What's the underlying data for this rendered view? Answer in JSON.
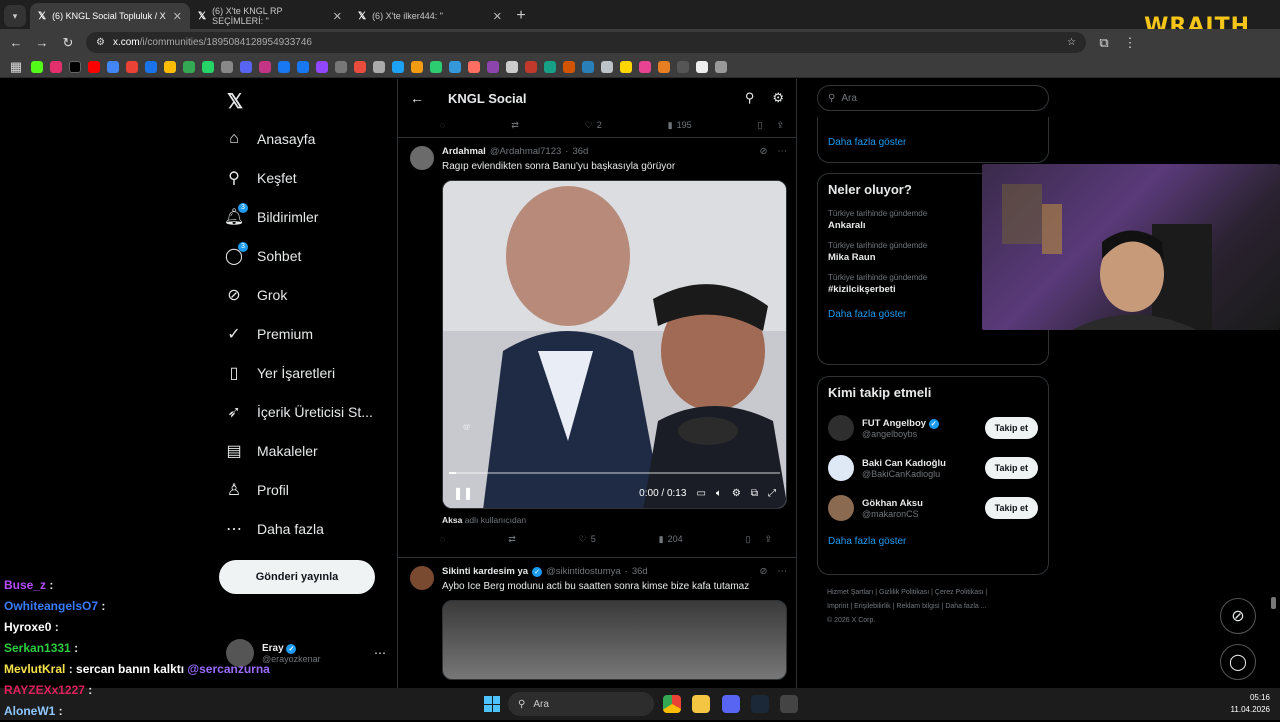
{
  "browser": {
    "tabs": [
      {
        "label": "(6) KNGL Social Topluluk / X",
        "active": true
      },
      {
        "label": "(6) X'te KNGL RP SEÇİMLERİ: \"",
        "active": false
      },
      {
        "label": "(6) X'te ilker444: \"",
        "active": false
      }
    ],
    "url_host": "x.com",
    "url_path": "/i/communities/1895084128954933746",
    "overlay_brand": "WRAITH"
  },
  "sidebar": {
    "items": [
      {
        "label": "Anasayfa",
        "icon": "home-icon"
      },
      {
        "label": "Keşfet",
        "icon": "search-icon"
      },
      {
        "label": "Bildirimler",
        "icon": "bell-icon",
        "badge": "3"
      },
      {
        "label": "Sohbet",
        "icon": "chat-icon",
        "badge": "3"
      },
      {
        "label": "Grok",
        "icon": "grok-icon"
      },
      {
        "label": "Premium",
        "icon": "verified-icon"
      },
      {
        "label": "Yer İşaretleri",
        "icon": "bookmark-icon"
      },
      {
        "label": "İçerik Üreticisi St...",
        "icon": "rocket-icon"
      },
      {
        "label": "Makaleler",
        "icon": "article-icon"
      },
      {
        "label": "Profil",
        "icon": "person-icon"
      },
      {
        "label": "Daha fazla",
        "icon": "more-icon"
      }
    ],
    "post_button": "Gönderi yayınla",
    "account": {
      "name": "Eray",
      "handle": "@erayozkenar"
    }
  },
  "main": {
    "title": "KNGL Social",
    "prev_post_stats": {
      "replies": "",
      "reposts": "",
      "likes": "2",
      "views": "195"
    },
    "posts": [
      {
        "name": "Ardahmal",
        "handle": "@Ardahmal7123",
        "age": "36d",
        "text": "Ragıp evlendikten sonra Banu'yu başkasıyla görüyor",
        "video_time": "0:00 / 0:13",
        "video_progress": 0.02,
        "credit_strong": "Aksa",
        "credit_rest": "adlı kullanıcıdan",
        "stats": {
          "likes": "5",
          "views": "204"
        }
      },
      {
        "name": "Sikinti kardesim ya",
        "handle": "@sikintidostumya",
        "age": "36d",
        "text": "Aybo Ice Berg modunu acti bu saatten sonra kimse bize kafa tutamaz"
      }
    ]
  },
  "right": {
    "search_placeholder": "Ara",
    "more_link": "Daha fazla göster",
    "trends_title": "Neler oluyor?",
    "trends": [
      {
        "context": "Türkiye tarihinde gündemde",
        "topic": "Ankaralı"
      },
      {
        "context": "Türkiye tarihinde gündemde",
        "topic": "Mika Raun"
      },
      {
        "context": "Türkiye tarihinde gündemde",
        "topic": "#kizilcikşerbeti"
      }
    ],
    "who_to_follow_title": "Kimi takip etmeli",
    "follow_label": "Takip et",
    "suggestions": [
      {
        "name": "FUT Angelboy",
        "handle": "@angelboybs",
        "verified": true
      },
      {
        "name": "Baki Can Kadıoğlu",
        "handle": "@BakiCanKadioglu",
        "verified": false
      },
      {
        "name": "Gökhan Aksu",
        "handle": "@makaronCS",
        "verified": false
      }
    ],
    "footer": {
      "links": [
        "Hizmet Şartları",
        "Gizlilik Politikası",
        "Çerez Politikası",
        "Imprint",
        "Erişilebilirlik",
        "Reklam bilgisi",
        "Daha fazla ..."
      ],
      "copyright": "© 2026 X Corp."
    }
  },
  "chat": [
    {
      "user": "Buse_z",
      "color": "#b44dff",
      "msg": ""
    },
    {
      "user": "OwhiteangelsO7",
      "color": "#3a7bff",
      "msg": ""
    },
    {
      "user": "Hyroxe0",
      "color": "#ffffff",
      "msg": ""
    },
    {
      "user": "Serkan1331",
      "color": "#2ecc40",
      "msg": ""
    },
    {
      "user": "MevlutKral",
      "color": "#f5e14a",
      "msg": "sercan banın kalktı",
      "mention": "@sercanzurna"
    },
    {
      "user": "RAYZEXx1227",
      "color": "#e0205a",
      "msg": ""
    },
    {
      "user": "AloneW1",
      "color": "#8fc7ff",
      "msg": ""
    }
  ],
  "taskbar": {
    "search": "Ara",
    "time": "05:16",
    "date": "11.04.2026"
  }
}
